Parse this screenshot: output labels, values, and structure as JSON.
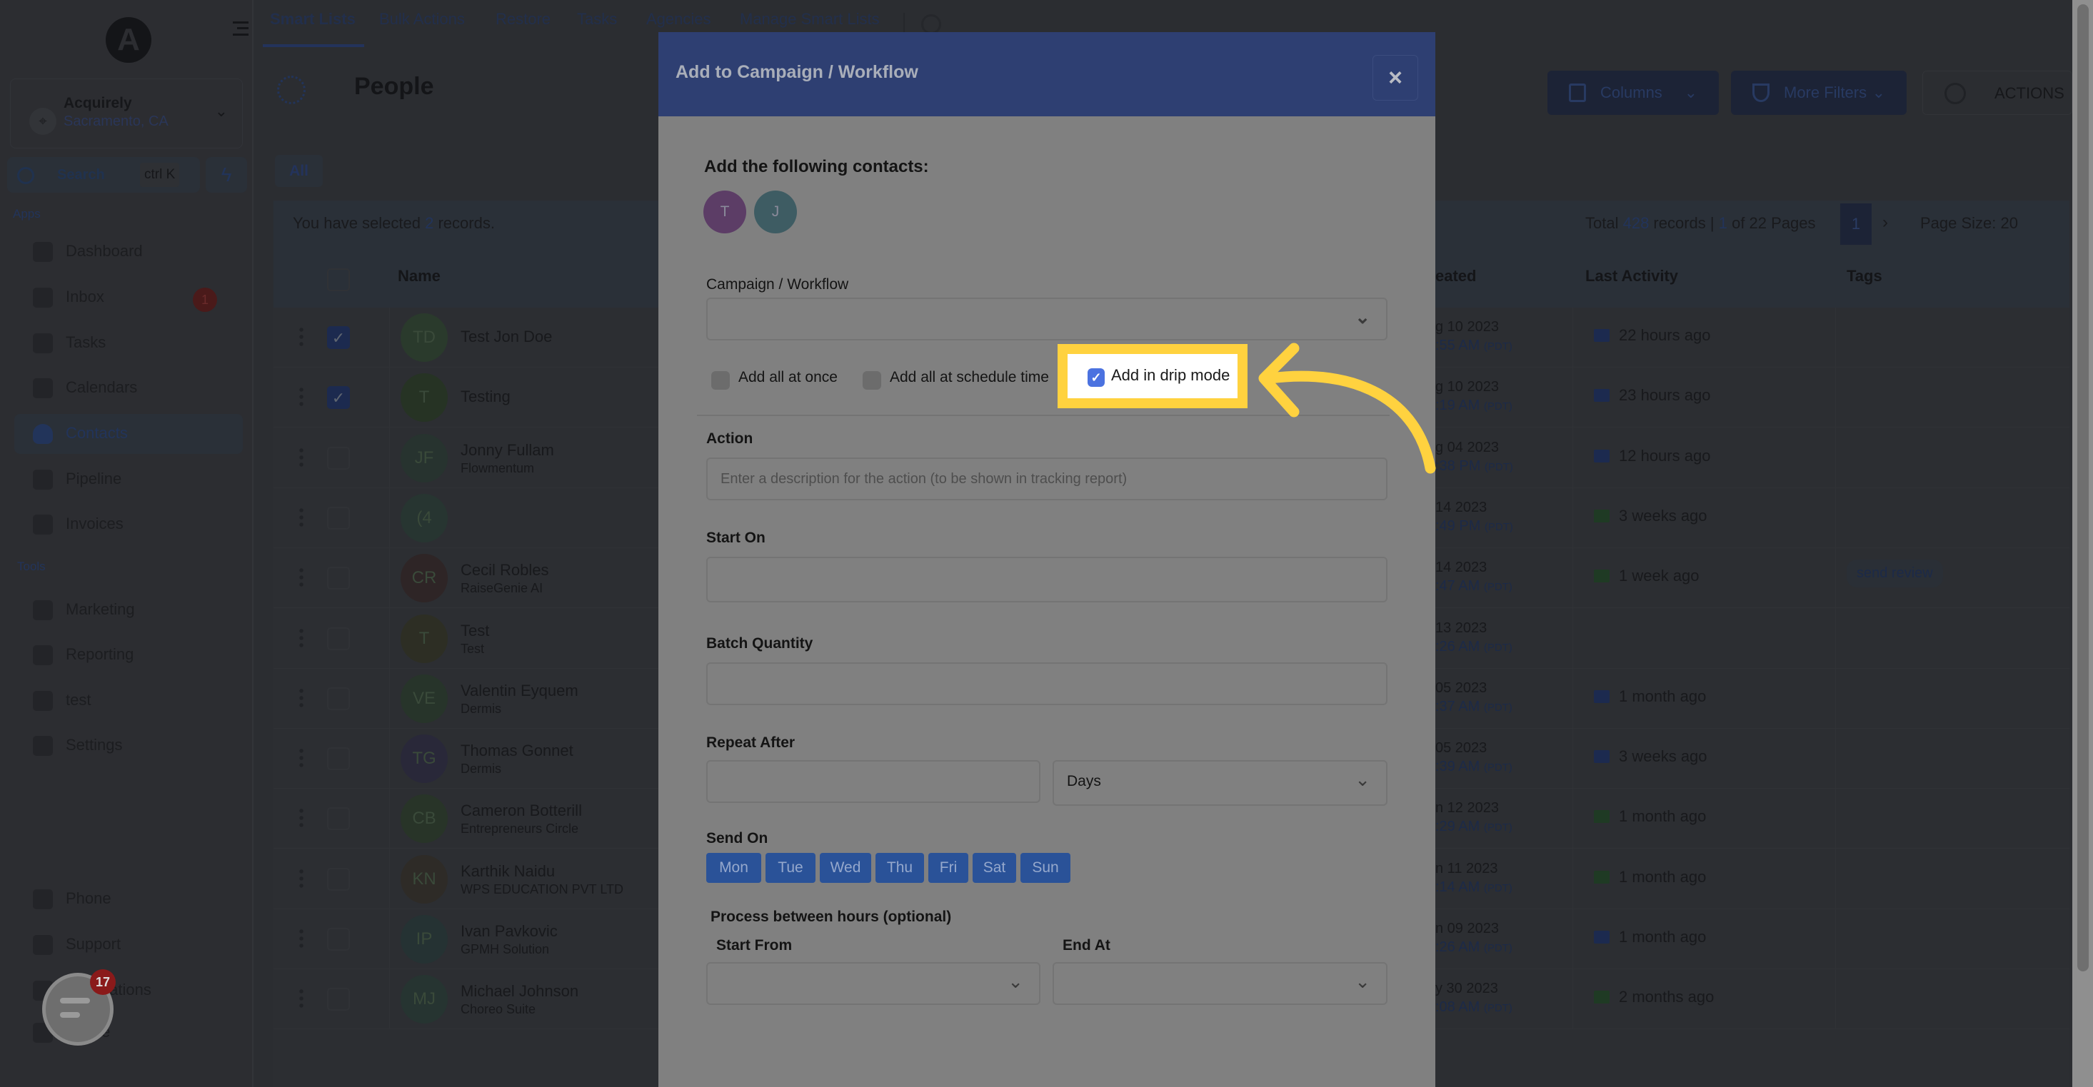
{
  "sidebar": {
    "logo_letter": "A",
    "location": {
      "name": "Acquirely",
      "city": "Sacramento, CA"
    },
    "search": {
      "label": "Search",
      "shortcut": "ctrl K"
    },
    "apps_label": "Apps",
    "tools_label": "Tools",
    "apps": [
      {
        "label": "Dashboard"
      },
      {
        "label": "Inbox",
        "badge": "1"
      },
      {
        "label": "Tasks"
      },
      {
        "label": "Calendars"
      },
      {
        "label": "Contacts",
        "active": true
      },
      {
        "label": "Pipeline"
      },
      {
        "label": "Invoices"
      }
    ],
    "tools": [
      {
        "label": "Marketing"
      },
      {
        "label": "Reporting"
      },
      {
        "label": "test"
      },
      {
        "label": "Settings"
      }
    ],
    "bottom": [
      {
        "label": "Phone"
      },
      {
        "label": "Support"
      },
      {
        "label": "Notifications"
      },
      {
        "label": "Profile"
      }
    ],
    "chat_badge": "17"
  },
  "top_tabs": [
    "Smart Lists",
    "Bulk Actions",
    "Restore",
    "Tasks",
    "Agencies",
    "Manage Smart Lists"
  ],
  "page": {
    "title": "People",
    "columns_label": "Columns",
    "filters_label": "More Filters",
    "actions_label": "ACTIONS",
    "all_tab": "All",
    "selection": {
      "prefix": "You have selected ",
      "count": "2",
      "suffix": " records."
    },
    "pagination": {
      "prefix": "Total ",
      "total": "428",
      "mid": " records | ",
      "page": "1",
      "suffix": " of 22 Pages",
      "current": "1",
      "next": "›",
      "page_size": "Page Size: 20"
    }
  },
  "table": {
    "headers": {
      "name": "Name",
      "created": "eated",
      "last_activity": "Last Activity",
      "tags": "Tags"
    },
    "rows": [
      {
        "initials": "TD",
        "name": "Test Jon Doe",
        "company": "",
        "date": "g 10 2023",
        "time": ":55 AM",
        "tz": "(PDT)",
        "activity_icon": "email",
        "activity": "22 hours ago",
        "checked": true,
        "color": "#2a3a2c"
      },
      {
        "initials": "T",
        "name": "Testing",
        "company": "",
        "date": "g 10 2023",
        "time": ":19 AM",
        "tz": "(PDT)",
        "activity_icon": "email",
        "activity": "23 hours ago",
        "checked": true,
        "color": "#263324"
      },
      {
        "initials": "JF",
        "name": "Jonny Fullam",
        "company": "Flowmentum",
        "date": "g 04 2023",
        "time": ":38 PM",
        "tz": "(PDT)",
        "activity_icon": "email",
        "activity": "12 hours ago",
        "checked": false,
        "color": "#27332f"
      },
      {
        "initials": "(4",
        "name": "",
        "company": "",
        "date": "14 2023",
        "time": ":49 PM",
        "tz": "(PDT)",
        "activity_icon": "sms",
        "activity": "3 weeks ago",
        "checked": false,
        "color": "#273531"
      },
      {
        "initials": "CR",
        "name": "Cecil Robles",
        "company": "RaiseGenie AI",
        "date": "14 2023",
        "time": ":47 AM",
        "tz": "(PDT)",
        "activity_icon": "sms",
        "activity": "1 week ago",
        "checked": false,
        "color": "#2e2526",
        "tag": "send review"
      },
      {
        "initials": "T",
        "name": "Test",
        "company": "Test",
        "date": "13 2023",
        "time": ":26 AM",
        "tz": "(PDT)",
        "activity_icon": "",
        "activity": "",
        "checked": false,
        "color": "#2d2e24"
      },
      {
        "initials": "VE",
        "name": "Valentin Eyquem",
        "company": "Dermis",
        "date": "05 2023",
        "time": ":37 AM",
        "tz": "(PDT)",
        "activity_icon": "email",
        "activity": "1 month ago",
        "checked": false,
        "color": "#27342a"
      },
      {
        "initials": "TG",
        "name": "Thomas Gonnet",
        "company": "Dermis",
        "date": "05 2023",
        "time": ":39 AM",
        "tz": "(PDT)",
        "activity_icon": "email",
        "activity": "3 weeks ago",
        "checked": false,
        "color": "#292839"
      },
      {
        "initials": "CB",
        "name": "Cameron Botterill",
        "company": "Entrepreneurs Circle",
        "date": "n 12 2023",
        "time": ":29 AM",
        "tz": "(PDT)",
        "activity_icon": "sms",
        "activity": "1 month ago",
        "checked": false,
        "color": "#283428"
      },
      {
        "initials": "KN",
        "name": "Karthik Naidu",
        "company": "WPS EDUCATION PVT LTD",
        "date": "n 11 2023",
        "time": ":14 AM",
        "tz": "(PDT)",
        "activity_icon": "sms",
        "activity": "1 month ago",
        "checked": false,
        "color": "#2e2b27"
      },
      {
        "initials": "IP",
        "name": "Ivan Pavkovic",
        "company": "GPMH Solution",
        "date": "n 09 2023",
        "time": ":26 AM",
        "tz": "(PDT)",
        "activity_icon": "email",
        "activity": "1 month ago",
        "checked": false,
        "color": "#253233"
      },
      {
        "initials": "MJ",
        "name": "Michael Johnson",
        "company": "Choreo Suite",
        "date": "y 30 2023",
        "time": ":08 AM",
        "tz": "(PDT)",
        "activity_icon": "sms",
        "activity": "2 months ago",
        "checked": false,
        "color": "#263431"
      }
    ]
  },
  "modal": {
    "title": "Add to Campaign / Workflow",
    "close_icon": "×",
    "contacts_heading": "Add the following contacts:",
    "contacts": [
      {
        "initial": "T",
        "color": "#5c3d66"
      },
      {
        "initial": "J",
        "color": "#3e5c63"
      }
    ],
    "campaign_label": "Campaign / Workflow",
    "campaign_value": "",
    "modes": [
      {
        "label": "Add all at once",
        "checked": false
      },
      {
        "label": "Add all at schedule time",
        "checked": false
      },
      {
        "label": "Add in drip mode",
        "checked": true
      }
    ],
    "action_label": "Action",
    "action_placeholder": "Enter a description for the action (to be shown in tracking report)",
    "start_on_label": "Start On",
    "batch_label": "Batch Quantity",
    "repeat_label": "Repeat After",
    "repeat_unit": "Days",
    "send_on_label": "Send On",
    "days": [
      "Mon",
      "Tue",
      "Wed",
      "Thu",
      "Fri",
      "Sat",
      "Sun"
    ],
    "hours_label": "Process between hours (optional)",
    "start_from_label": "Start From",
    "end_at_label": "End At"
  },
  "colors": {
    "highlight": "#ffd23f",
    "modal_header": "#5a7ce0",
    "day_button": "#2a5298",
    "checkbox": "#4b72e0"
  }
}
